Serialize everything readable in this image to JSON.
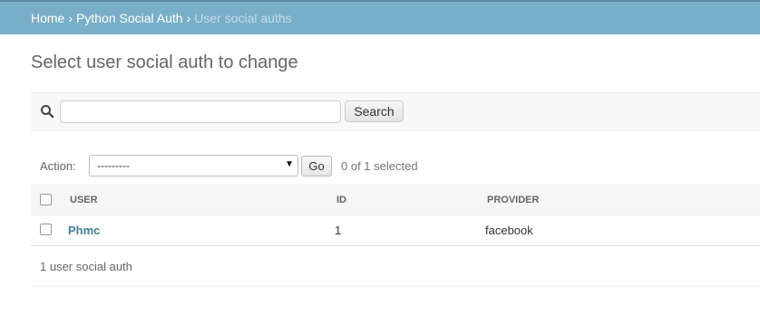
{
  "breadcrumbs": {
    "home": "Home",
    "app": "Python Social Auth",
    "current": "User social auths",
    "separator": "›"
  },
  "page_title": "Select user social auth to change",
  "search": {
    "value": "",
    "placeholder": "",
    "button_label": "Search"
  },
  "actions": {
    "label": "Action:",
    "selected": "---------",
    "go_label": "Go",
    "selection_count": "0 of 1 selected"
  },
  "table": {
    "headers": [
      "USER",
      "ID",
      "PROVIDER"
    ],
    "rows": [
      {
        "user": "Phmc",
        "id": "1",
        "provider": "facebook"
      }
    ]
  },
  "paginator": "1 user social auth",
  "colors": {
    "header_bg": "#79aec8",
    "link": "#447e9b"
  }
}
